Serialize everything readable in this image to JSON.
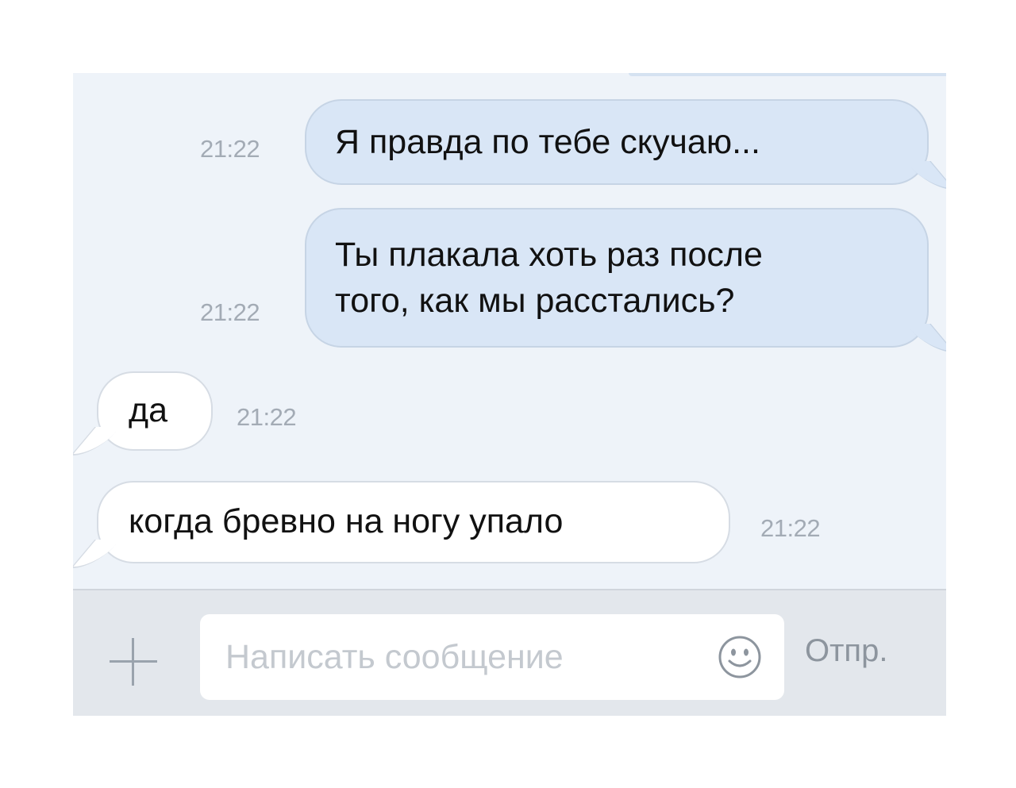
{
  "messages": [
    {
      "direction": "outgoing",
      "lines": [
        "Я правда по тебе скучаю..."
      ],
      "time": "21:22"
    },
    {
      "direction": "outgoing",
      "lines": [
        "Ты плакала хоть раз после",
        "того, как мы расстались?"
      ],
      "time": "21:22"
    },
    {
      "direction": "incoming",
      "lines": [
        "да"
      ],
      "time": "21:22"
    },
    {
      "direction": "incoming",
      "lines": [
        "когда бревно на ногу упало"
      ],
      "time": "21:22"
    }
  ],
  "composer": {
    "attach_icon": "plus-icon",
    "placeholder": "Написать сообщение",
    "emoji_icon": "smiley-icon",
    "send_label": "Отпр."
  },
  "colors": {
    "background": "#eef3f9",
    "outgoing_bubble": "#d9e6f6",
    "incoming_bubble": "#ffffff",
    "timestamp": "#a3abb5",
    "input_bar": "#e3e7ec"
  }
}
